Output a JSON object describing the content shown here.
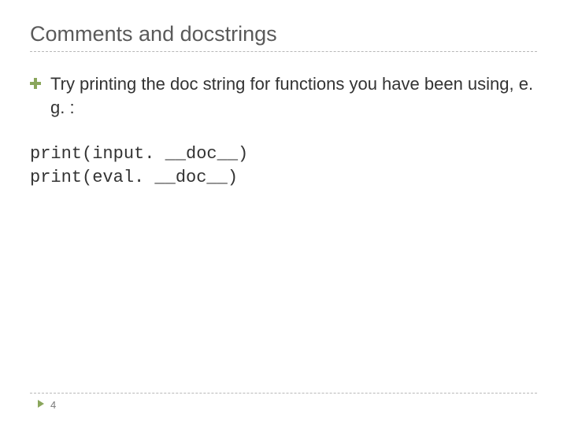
{
  "title": "Comments and docstrings",
  "bullet": {
    "text": "Try printing the doc string for functions you have been using, e. g. :"
  },
  "code": {
    "line1": "print(input. __doc__)",
    "line2": "print(eval. __doc__)"
  },
  "footer": {
    "page_number": "4"
  }
}
